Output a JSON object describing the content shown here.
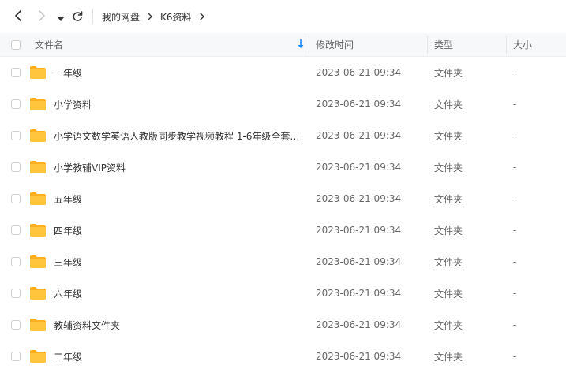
{
  "toolbar": {
    "back_icon": "chevron-left-icon",
    "forward_icon": "chevron-right-icon",
    "history_icon": "caret-down-icon",
    "refresh_icon": "refresh-icon",
    "breadcrumb": [
      "我的网盘",
      "K6资料"
    ]
  },
  "header": {
    "name": "文件名",
    "mtime": "修改时间",
    "type": "类型",
    "size": "大小",
    "sort_icon": "sort-down-arrow-icon",
    "accent": "#1a8cff"
  },
  "colors": {
    "folder": "#ffc53d",
    "folder_tab": "#ffb01f",
    "header_bg": "#f7f8fa"
  },
  "files": [
    {
      "name": "一年级",
      "mtime": "2023-06-21 09:34",
      "type": "文件夹",
      "size": "-"
    },
    {
      "name": "小学资料",
      "mtime": "2023-06-21 09:34",
      "type": "文件夹",
      "size": "-"
    },
    {
      "name": "小学语文数学英语人教版同步教学视频教程 1-6年级全套…",
      "mtime": "2023-06-21 09:34",
      "type": "文件夹",
      "size": "-"
    },
    {
      "name": "小学教辅VIP资料",
      "mtime": "2023-06-21 09:34",
      "type": "文件夹",
      "size": "-"
    },
    {
      "name": "五年级",
      "mtime": "2023-06-21 09:34",
      "type": "文件夹",
      "size": "-"
    },
    {
      "name": "四年级",
      "mtime": "2023-06-21 09:34",
      "type": "文件夹",
      "size": "-"
    },
    {
      "name": "三年级",
      "mtime": "2023-06-21 09:34",
      "type": "文件夹",
      "size": "-"
    },
    {
      "name": "六年级",
      "mtime": "2023-06-21 09:34",
      "type": "文件夹",
      "size": "-"
    },
    {
      "name": "教辅资料文件夹",
      "mtime": "2023-06-21 09:34",
      "type": "文件夹",
      "size": "-"
    },
    {
      "name": "二年级",
      "mtime": "2023-06-21 09:34",
      "type": "文件夹",
      "size": "-"
    }
  ]
}
